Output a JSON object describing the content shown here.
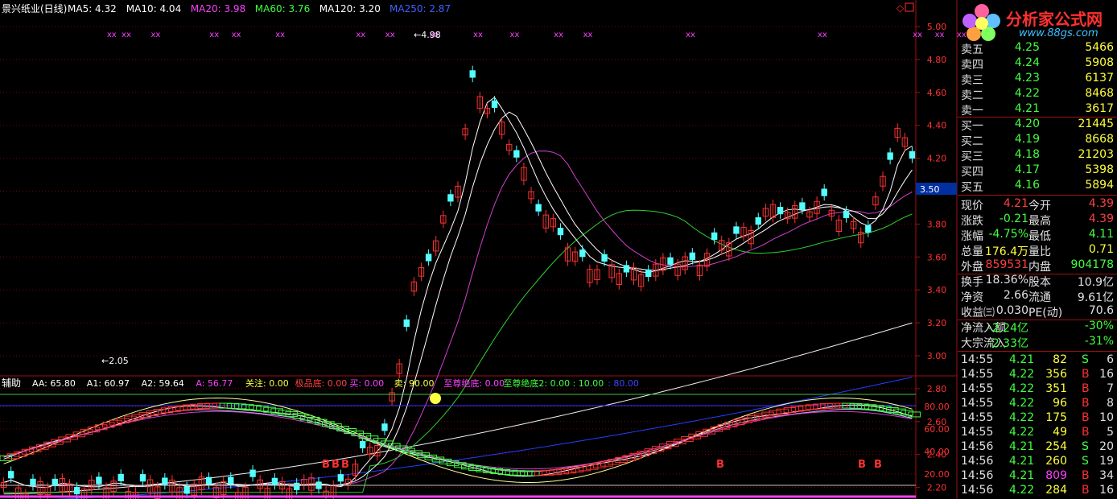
{
  "header": {
    "title": "景兴纸业(日线)",
    "ma": [
      {
        "label": "MA5: 4.32",
        "color": "#ffffff"
      },
      {
        "label": "MA10: 4.04",
        "color": "#ffffff"
      },
      {
        "label": "MA20: 3.98",
        "color": "#ff40ff"
      },
      {
        "label": "MA60: 3.76",
        "color": "#40ff40"
      },
      {
        "label": "MA120: 3.20",
        "color": "#ffffff"
      },
      {
        "label": "MA250: 2.87",
        "color": "#4060ff"
      }
    ]
  },
  "sub_header": {
    "name": "辅助",
    "items": [
      {
        "label": "AA: 65.80",
        "color": "#ffffff"
      },
      {
        "label": "A1: 60.97",
        "color": "#ffffff"
      },
      {
        "label": "A2: 59.64",
        "color": "#ffffff"
      },
      {
        "label": "A: 56.77",
        "color": "#ff40ff"
      },
      {
        "label": "关注: 0.00",
        "color": "#ffff40"
      },
      {
        "label": "极品底: 0.00",
        "color": "#ff4040"
      },
      {
        "label": "买: 0.00",
        "color": "#ff40ff"
      },
      {
        "label": "卖: 90.00",
        "color": "#ffff40"
      },
      {
        "label": "至尊绝底: 0.00",
        "color": "#ff40ff"
      },
      {
        "label": "至尊绝底2: 0.00 : 10.00",
        "color": "#40ff40"
      },
      {
        "label": ": 80.00",
        "color": "#4040ff"
      }
    ]
  },
  "annotations": {
    "high": "4.98",
    "low": "2.05",
    "buy_marks": [
      "B",
      "B",
      "B",
      "B",
      "B",
      "B"
    ],
    "sell_marks": [
      "x"
    ]
  },
  "price_axis": {
    "ticks": [
      "5.00",
      "4.80",
      "4.60",
      "4.40",
      "4.20",
      "4.00",
      "3.80",
      "3.60",
      "3.40",
      "3.20",
      "3.00",
      "2.80",
      "2.60",
      "2.40",
      "2.20"
    ],
    "current_label": "3.50"
  },
  "sub_axis": {
    "ticks": [
      "80.00",
      "60.00",
      "40.00",
      "20.00"
    ]
  },
  "logo": {
    "text": "分析家公式网",
    "url_text": "www.88gs.com"
  },
  "order_book": [
    {
      "label": "卖五",
      "price": "4.25",
      "vol": "5466"
    },
    {
      "label": "卖四",
      "price": "4.24",
      "vol": "5908"
    },
    {
      "label": "卖三",
      "price": "4.23",
      "vol": "6137"
    },
    {
      "label": "卖二",
      "price": "4.22",
      "vol": "8468"
    },
    {
      "label": "卖一",
      "price": "4.21",
      "vol": "3617"
    },
    {
      "label": "买一",
      "price": "4.20",
      "vol": "21445"
    },
    {
      "label": "买二",
      "price": "4.19",
      "vol": "8668"
    },
    {
      "label": "买三",
      "price": "4.18",
      "vol": "21203"
    },
    {
      "label": "买四",
      "price": "4.17",
      "vol": "5398"
    },
    {
      "label": "买五",
      "price": "4.16",
      "vol": "5894"
    }
  ],
  "stats": [
    {
      "l1": "现价",
      "v1": "4.21",
      "c1": "#ff4040",
      "l2": "今开",
      "v2": "4.39",
      "c2": "#ff4040"
    },
    {
      "l1": "涨跌",
      "v1": "-0.21",
      "c1": "#40ff40",
      "l2": "最高",
      "v2": "4.39",
      "c2": "#ff4040"
    },
    {
      "l1": "涨幅",
      "v1": "-4.75%",
      "c1": "#40ff40",
      "l2": "最低",
      "v2": "4.11",
      "c2": "#40ff40"
    },
    {
      "l1": "总量",
      "v1": "176.4万",
      "c1": "#ffff40",
      "l2": "量比",
      "v2": "0.71",
      "c2": "#ffff40"
    },
    {
      "l1": "外盘",
      "v1": "859531",
      "c1": "#ff4040",
      "l2": "内盘",
      "v2": "904178",
      "c2": "#40ff40"
    },
    {
      "l1": "换手",
      "v1": "18.36%",
      "c1": "#e0e0e0",
      "l2": "股本",
      "v2": "10.9亿",
      "c2": "#e0e0e0"
    },
    {
      "l1": "净资",
      "v1": "2.66",
      "c1": "#e0e0e0",
      "l2": "流通",
      "v2": "9.61亿",
      "c2": "#e0e0e0"
    },
    {
      "l1": "收益㈢",
      "v1": "0.030",
      "c1": "#e0e0e0",
      "l2": "PE(动)",
      "v2": "70.6",
      "c2": "#e0e0e0"
    },
    {
      "l1": "净流入额",
      "v1": "-2.24亿",
      "c1": "#40ff40",
      "l2": "",
      "v2": "-30%",
      "c2": "#40ff40"
    },
    {
      "l1": "大宗流入",
      "v1": "-2.33亿",
      "c1": "#40ff40",
      "l2": "",
      "v2": "-31%",
      "c2": "#40ff40"
    }
  ],
  "ticks": [
    {
      "time": "14:55",
      "price": "4.21",
      "vol": "82",
      "side": "S",
      "n": "6"
    },
    {
      "time": "14:55",
      "price": "4.22",
      "vol": "356",
      "side": "B",
      "n": "16"
    },
    {
      "time": "14:55",
      "price": "4.22",
      "vol": "351",
      "side": "B",
      "n": "7"
    },
    {
      "time": "14:55",
      "price": "4.22",
      "vol": "96",
      "side": "B",
      "n": "8"
    },
    {
      "time": "14:55",
      "price": "4.22",
      "vol": "175",
      "side": "B",
      "n": "10"
    },
    {
      "time": "14:55",
      "price": "4.22",
      "vol": "49",
      "side": "B",
      "n": "5"
    },
    {
      "time": "14:56",
      "price": "4.21",
      "vol": "254",
      "side": "S",
      "n": "20"
    },
    {
      "time": "14:56",
      "price": "4.21",
      "vol": "260",
      "side": "S",
      "n": "19"
    },
    {
      "time": "14:56",
      "price": "4.21",
      "vol": "809",
      "side": "B",
      "n": "34"
    },
    {
      "time": "14:56",
      "price": "4.22",
      "vol": "284",
      "side": "B",
      "n": "16"
    }
  ],
  "colors": {
    "up": "#ff3030",
    "down": "#54ffff",
    "grid": "#800000",
    "axis": "#a01010"
  }
}
